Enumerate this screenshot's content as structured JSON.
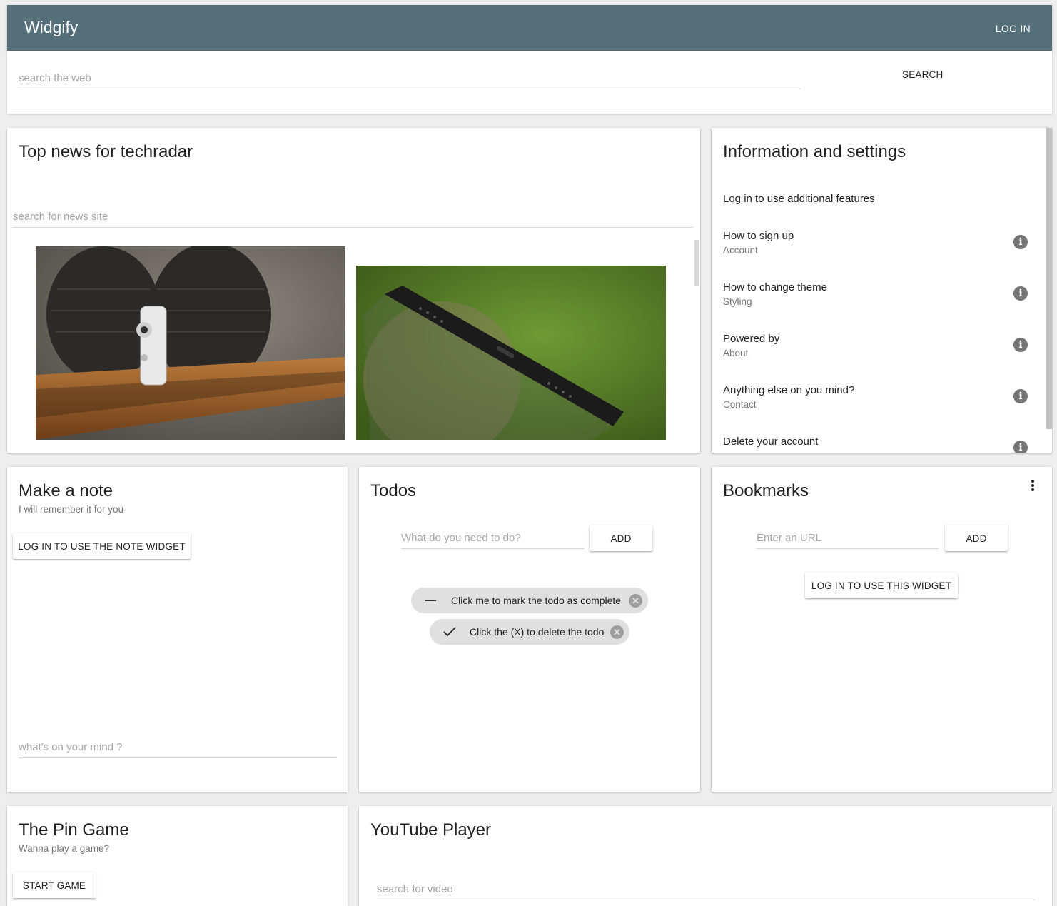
{
  "header": {
    "title": "Widgify",
    "login_label": "LOG IN"
  },
  "web_search": {
    "placeholder": "search the web",
    "button_label": "SEARCH"
  },
  "news": {
    "title": "Top news for techradar",
    "search_placeholder": "search for news site",
    "articles": [
      {
        "image": "home-camera-photo"
      },
      {
        "image": "smartphone-edge-photo"
      }
    ]
  },
  "info": {
    "title": "Information and settings",
    "intro": "Log in to use additional features",
    "items": [
      {
        "primary": "How to sign up",
        "secondary": "Account"
      },
      {
        "primary": "How to change theme",
        "secondary": "Styling"
      },
      {
        "primary": "Powered by",
        "secondary": "About"
      },
      {
        "primary": "Anything else on you mind?",
        "secondary": "Contact"
      },
      {
        "primary": "Delete your account",
        "secondary": ""
      }
    ]
  },
  "note": {
    "title": "Make a note",
    "subtitle": "I will remember it for you",
    "login_button": "LOG IN TO USE THE NOTE WIDGET",
    "placeholder": "what's on your mind ?"
  },
  "todos": {
    "title": "Todos",
    "placeholder": "What do you need to do?",
    "add_label": "ADD",
    "items": [
      {
        "text": "Click me to mark the todo as complete",
        "status_icon": "minus-icon"
      },
      {
        "text": "Click the (X) to delete the todo",
        "status_icon": "check-icon"
      }
    ]
  },
  "bookmarks": {
    "title": "Bookmarks",
    "placeholder": "Enter an URL",
    "add_label": "ADD",
    "login_button": "LOG IN TO USE THIS WIDGET"
  },
  "pin_game": {
    "title": "The Pin Game",
    "subtitle": "Wanna play a game?",
    "start_label": "START GAME"
  },
  "youtube": {
    "title": "YouTube Player",
    "search_placeholder": "search for video"
  },
  "colors": {
    "appbar": "#546e7a",
    "background": "#eeeeee",
    "chip": "#e0e0e0"
  }
}
